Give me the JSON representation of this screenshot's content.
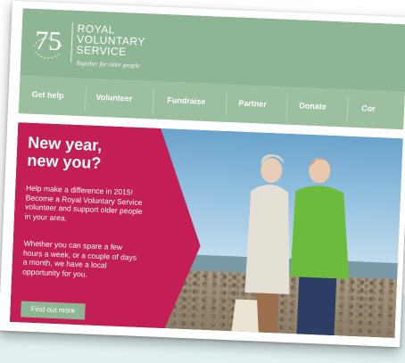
{
  "logo": {
    "anniversary": "75",
    "name_line1": "ROYAL",
    "name_line2": "VOLUNTARY",
    "name_line3": "SERVICE",
    "tagline": "Together for older people"
  },
  "nav": {
    "items": [
      {
        "label": "Get help"
      },
      {
        "label": "Volunteer"
      },
      {
        "label": "Fundraise"
      },
      {
        "label": "Partner"
      },
      {
        "label": "Donate"
      },
      {
        "label": "Cor"
      }
    ]
  },
  "hero": {
    "heading": "New year, new you?",
    "paragraph1": "Help make a difference in 2015! Become a Royal Voluntary Service volunteer and support older people in your area.",
    "paragraph2": "Whether you can spare a few hours a week, or a couple of days a month, we have a local opportunity for you.",
    "cta_label": "Find out more"
  },
  "colors": {
    "brand_green": "#8fb694",
    "accent_magenta": "#c31f55",
    "text_white": "#ffffff"
  },
  "icons": {
    "logo_mark": "75-anniversary-logo"
  }
}
